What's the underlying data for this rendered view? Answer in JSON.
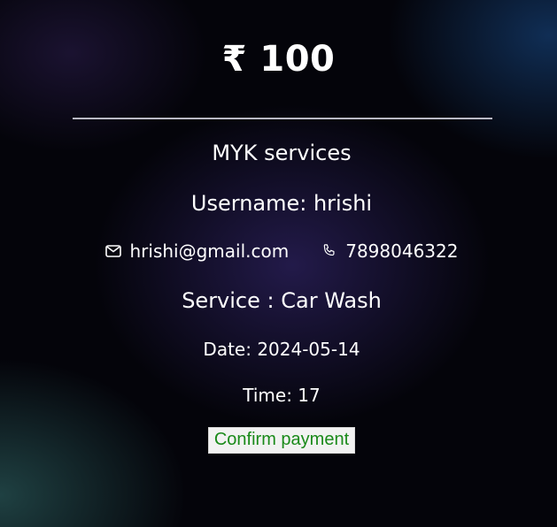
{
  "payment": {
    "amount": "₹ 100",
    "provider": "MYK services",
    "username": "Username: hrishi",
    "email": "hrishi@gmail.com",
    "phone": "7898046322",
    "service": "Service : Car Wash",
    "date": "Date: 2024-05-14",
    "time": "Time: 17",
    "confirm_label": "Confirm payment",
    "icons": {
      "email": "mail-icon",
      "phone": "phone-icon"
    },
    "colors": {
      "confirm_text": "#1a8a1a",
      "text": "#ffffff",
      "background": "#04040a"
    }
  }
}
